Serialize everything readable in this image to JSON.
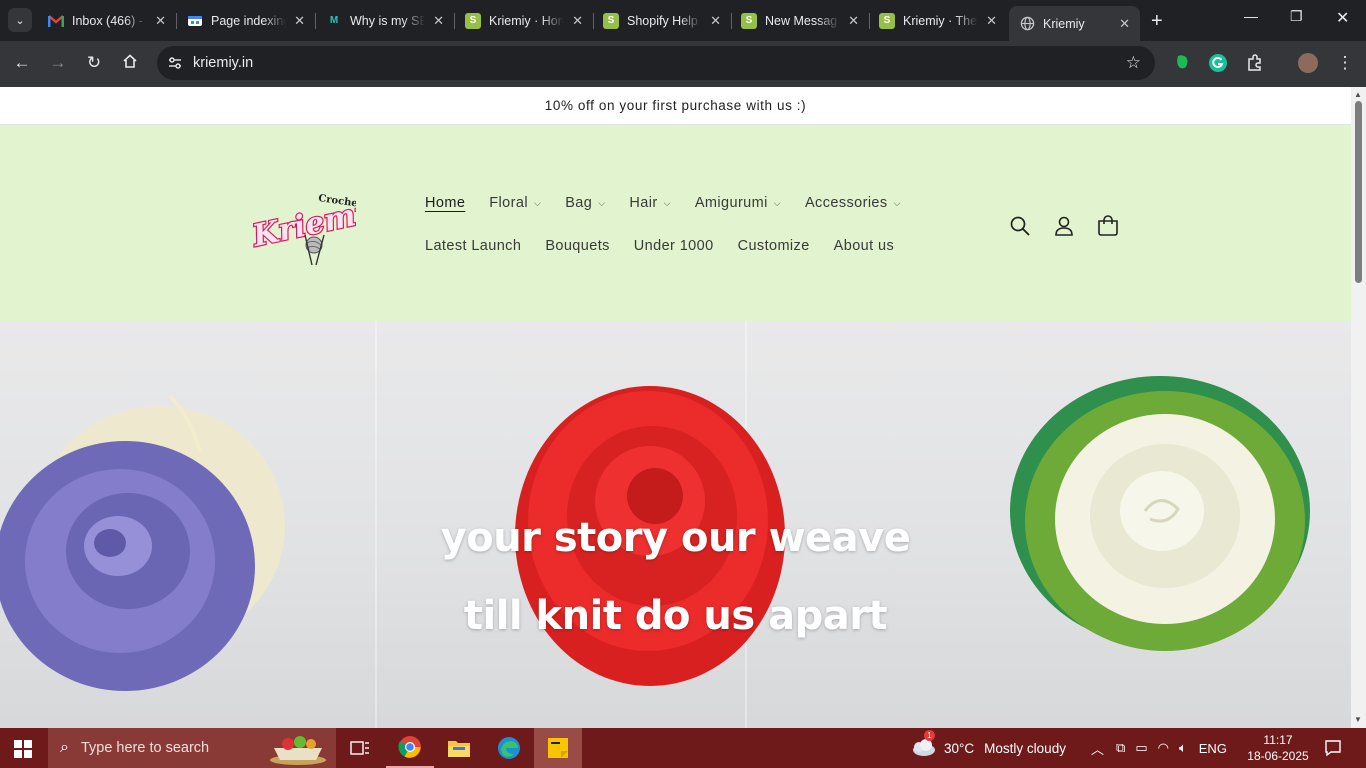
{
  "browser": {
    "tabs": [
      {
        "title": "Inbox (466) - ",
        "favicon": "gmail-icon",
        "active": false
      },
      {
        "title": "Page indexing",
        "favicon": "search-console-icon",
        "active": false
      },
      {
        "title": "Why is my SE",
        "favicon": "m-logo-icon",
        "active": false
      },
      {
        "title": "Kriemiy · Hon",
        "favicon": "shopify-icon",
        "active": false
      },
      {
        "title": "Shopify Help",
        "favicon": "shopify-icon",
        "active": false
      },
      {
        "title": "New Messag",
        "favicon": "shopify-icon",
        "active": false
      },
      {
        "title": "Kriemiy · The",
        "favicon": "shopify-icon",
        "active": false
      },
      {
        "title": "Kriemiy",
        "favicon": "globe-icon",
        "active": true
      }
    ],
    "url": "kriemiy.in"
  },
  "page": {
    "announcement": "10% off on your first purchase with us :)",
    "logo": {
      "script": "Kriemiy",
      "sub": "Crochet"
    },
    "nav_row1": [
      {
        "label": "Home",
        "dropdown": false,
        "current": true
      },
      {
        "label": "Floral",
        "dropdown": true
      },
      {
        "label": "Bag",
        "dropdown": true
      },
      {
        "label": "Hair",
        "dropdown": true
      },
      {
        "label": "Amigurumi",
        "dropdown": true
      },
      {
        "label": "Accessories",
        "dropdown": true
      }
    ],
    "nav_row2": [
      {
        "label": "Latest Launch"
      },
      {
        "label": "Bouquets"
      },
      {
        "label": "Under 1000"
      },
      {
        "label": "Customize"
      },
      {
        "label": "About us"
      }
    ],
    "hero": {
      "line1": "your story our weave",
      "line2": "till knit do us apart"
    },
    "colors": {
      "header_bg": "#e2f3cf",
      "logo_pink": "#d81b60"
    }
  },
  "taskbar": {
    "search_placeholder": "Type here to search",
    "weather": {
      "temp": "30°C",
      "condition": "Mostly cloudy",
      "badge": "1"
    },
    "language": "ENG",
    "time": "11:17",
    "date": "18-06-2025"
  }
}
